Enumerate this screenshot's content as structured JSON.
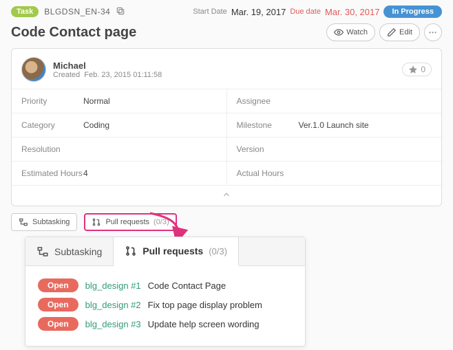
{
  "header": {
    "type_badge": "Task",
    "issue_key": "BLGDSN_EN-34",
    "start_label": "Start Date",
    "start_date": "Mar. 19, 2017",
    "due_label": "Due date",
    "due_date": "Mar. 30, 2017",
    "status": "In Progress"
  },
  "title": "Code Contact page",
  "actions": {
    "watch": "Watch",
    "edit": "Edit"
  },
  "creator": {
    "name": "Michael",
    "created_label": "Created",
    "created_at": "Feb. 23, 2015 01:11:58"
  },
  "star_count": "0",
  "fields_left": [
    {
      "label": "Priority",
      "value": "Normal"
    },
    {
      "label": "Category",
      "value": "Coding"
    },
    {
      "label": "Resolution",
      "value": ""
    },
    {
      "label": "Estimated Hours",
      "value": "4"
    }
  ],
  "fields_right": [
    {
      "label": "Assignee",
      "value": ""
    },
    {
      "label": "Milestone",
      "value": "Ver.1.0 Launch site"
    },
    {
      "label": "Version",
      "value": ""
    },
    {
      "label": "Actual Hours",
      "value": ""
    }
  ],
  "tabs": {
    "subtasking": "Subtasking",
    "pull_requests": "Pull requests",
    "pr_count": "(0/3)"
  },
  "zoom": {
    "subtasking": "Subtasking",
    "pull_requests": "Pull requests",
    "pr_count": "(0/3)",
    "items": [
      {
        "status": "Open",
        "link": "blg_design #1",
        "title": "Code Contact Page"
      },
      {
        "status": "Open",
        "link": "blg_design #2",
        "title": "Fix top page display problem"
      },
      {
        "status": "Open",
        "link": "blg_design #3",
        "title": "Update help screen wording"
      }
    ]
  }
}
